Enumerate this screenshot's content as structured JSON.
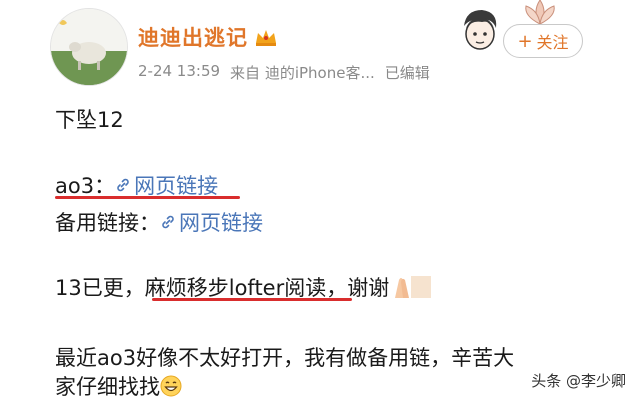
{
  "header": {
    "author_name": "迪迪出逃记",
    "timestamp": "2-24 13:59",
    "source": "来自 迪的iPhone客...",
    "edited": "已编辑",
    "follow_label": "关注",
    "follow_plus": "+"
  },
  "body": {
    "line1": "下坠12",
    "ao3_label": "ao3：",
    "ao3_link": "网页链接",
    "backup_label": "备用链接：",
    "backup_link": "网页链接",
    "line3_prefix": "13已更，",
    "line3_highlight": "麻烦移步lofter阅读",
    "line3_suffix": "，谢谢",
    "line4a": "最近ao3好像不太好打开，我有做备用链，辛苦大",
    "line4b": "家仔细找找"
  },
  "watermark": {
    "text": "头条 @李少卿"
  },
  "colors": {
    "author": "#e0762a",
    "link": "#4a76b8",
    "underline": "#d92d2d",
    "meta": "#8a8a8a"
  },
  "icons": [
    "crown-icon",
    "cartoon-face-icon",
    "succulent-icon",
    "link-icon",
    "praying-hands-emoji",
    "smile-emoji"
  ]
}
